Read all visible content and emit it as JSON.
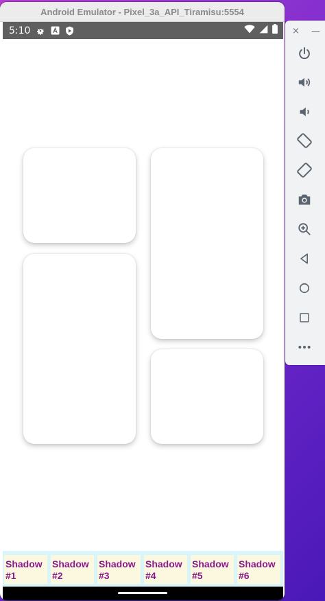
{
  "window": {
    "title": "Android Emulator - Pixel_3a_API_Tiramisu:5554"
  },
  "status_bar": {
    "time": "5:10"
  },
  "tabs": [
    {
      "label": "Shadow #1"
    },
    {
      "label": "Shadow #2"
    },
    {
      "label": "Shadow #3"
    },
    {
      "label": "Shadow #4"
    },
    {
      "label": "Shadow #5"
    },
    {
      "label": "Shadow #6"
    }
  ],
  "side_toolbar": {
    "header": {
      "close": "×",
      "minimize": "—"
    },
    "buttons": [
      "power-icon",
      "volume-up-icon",
      "volume-down-icon",
      "rotate-left-icon",
      "rotate-right-icon",
      "camera-icon",
      "zoom-icon",
      "back-icon",
      "home-icon",
      "overview-icon",
      "more-icon"
    ]
  },
  "colors": {
    "tab_text": "#8b1a8e",
    "tab_bg": "#fbf8df",
    "tab_bar_bg": "#d8f5fa",
    "status_bar_bg": "#5f5f5f",
    "toolbar_icon": "#5b6570"
  }
}
